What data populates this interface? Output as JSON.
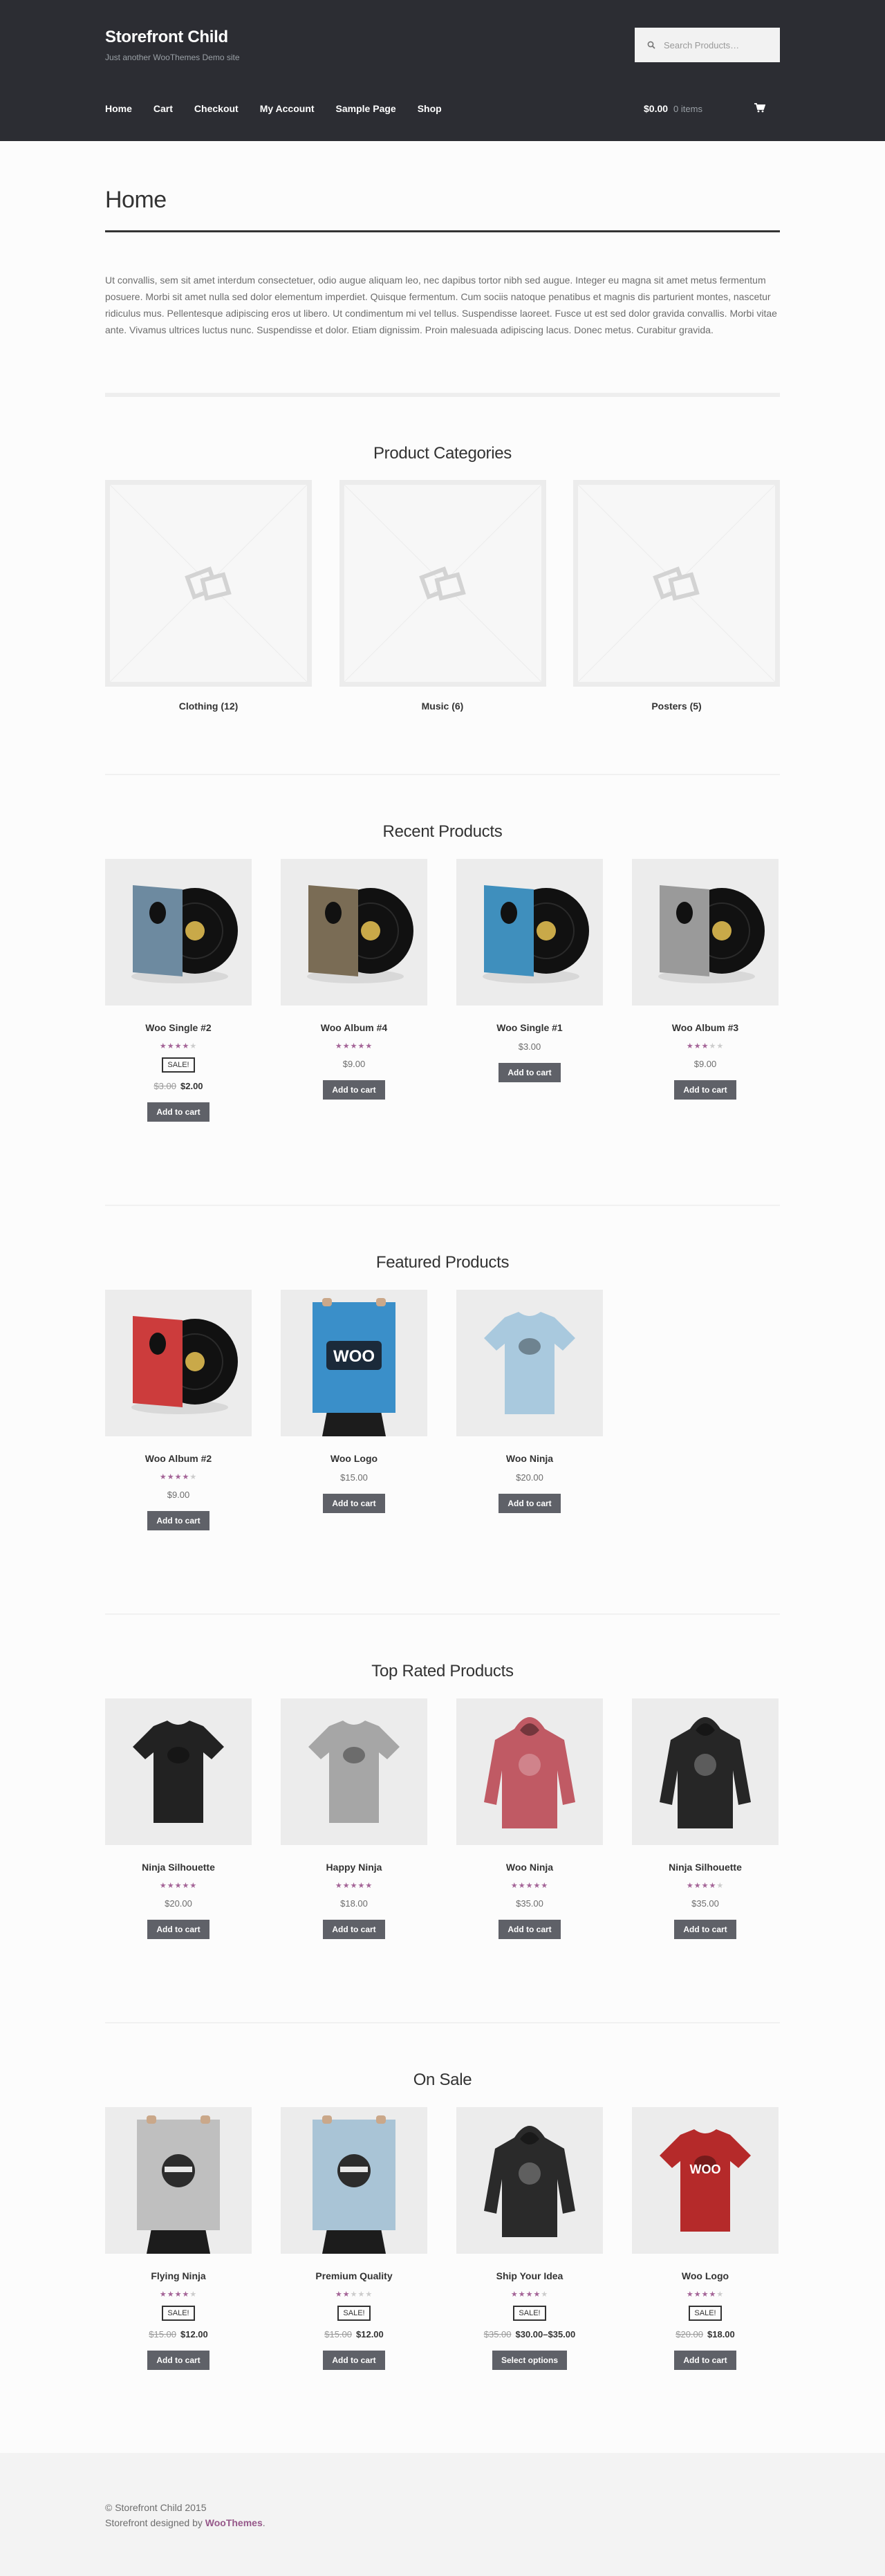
{
  "header": {
    "site_title": "Storefront Child",
    "tagline": "Just another WooThemes Demo site",
    "search_placeholder": "Search Products…",
    "nav": [
      "Home",
      "Cart",
      "Checkout",
      "My Account",
      "Sample Page",
      "Shop"
    ],
    "cart_amount": "$0.00",
    "cart_count": "0 items"
  },
  "page": {
    "title": "Home",
    "intro": "Ut convallis, sem sit amet interdum consectetuer, odio augue aliquam leo, nec dapibus tortor nibh sed augue. Integer eu magna sit amet metus fermentum posuere. Morbi sit amet nulla sed dolor elementum imperdiet. Quisque fermentum. Cum sociis natoque penatibus et magnis dis parturient montes, nascetur ridiculus mus. Pellentesque adipiscing eros ut libero. Ut condimentum mi vel tellus. Suspendisse laoreet. Fusce ut est sed dolor gravida convallis. Morbi vitae ante. Vivamus ultrices luctus nunc. Suspendisse et dolor. Etiam dignissim. Proin malesuada adipiscing lacus. Donec metus. Curabitur gravida."
  },
  "categories": {
    "title": "Product Categories",
    "items": [
      {
        "name": "Clothing",
        "count": "(12)"
      },
      {
        "name": "Music",
        "count": "(6)"
      },
      {
        "name": "Posters",
        "count": "(5)"
      }
    ]
  },
  "sections": [
    {
      "title": "Recent Products",
      "products": [
        {
          "name": "Woo Single #2",
          "rating": 4.5,
          "sale": "SALE!",
          "old_price": "$3.00",
          "price": "$2.00",
          "button": "Add to cart",
          "art": "vinyl",
          "color": "#6d8aa0"
        },
        {
          "name": "Woo Album #4",
          "rating": 5,
          "sale": "",
          "old_price": "",
          "price": "$9.00",
          "button": "Add to cart",
          "art": "vinyl",
          "color": "#7a6c55"
        },
        {
          "name": "Woo Single #1",
          "rating": 0,
          "sale": "",
          "old_price": "",
          "price": "$3.00",
          "button": "Add to cart",
          "art": "vinyl",
          "color": "#3f8fbd"
        },
        {
          "name": "Woo Album #3",
          "rating": 3,
          "sale": "",
          "old_price": "",
          "price": "$9.00",
          "button": "Add to cart",
          "art": "vinyl",
          "color": "#9a9a9a"
        }
      ]
    },
    {
      "title": "Featured Products",
      "products": [
        {
          "name": "Woo Album #2",
          "rating": 4,
          "sale": "",
          "old_price": "",
          "price": "$9.00",
          "button": "Add to cart",
          "art": "vinyl",
          "color": "#cc3c3c"
        },
        {
          "name": "Woo Logo",
          "rating": 0,
          "sale": "",
          "old_price": "",
          "price": "$15.00",
          "button": "Add to cart",
          "art": "poster",
          "color": "#3a8fc9",
          "logo": "WOO"
        },
        {
          "name": "Woo Ninja",
          "rating": 0,
          "sale": "",
          "old_price": "",
          "price": "$20.00",
          "button": "Add to cart",
          "art": "tshirt",
          "color": "#a9c9de"
        }
      ]
    },
    {
      "title": "Top Rated Products",
      "products": [
        {
          "name": "Ninja Silhouette",
          "rating": 5,
          "sale": "",
          "old_price": "",
          "price": "$20.00",
          "button": "Add to cart",
          "art": "tshirt",
          "color": "#222222"
        },
        {
          "name": "Happy Ninja",
          "rating": 5,
          "sale": "",
          "old_price": "",
          "price": "$18.00",
          "button": "Add to cart",
          "art": "tshirt",
          "color": "#a6a6a6"
        },
        {
          "name": "Woo Ninja",
          "rating": 5,
          "sale": "",
          "old_price": "",
          "price": "$35.00",
          "button": "Add to cart",
          "art": "hoodie",
          "color": "#c05a64"
        },
        {
          "name": "Ninja Silhouette",
          "rating": 4,
          "sale": "",
          "old_price": "",
          "price": "$35.00",
          "button": "Add to cart",
          "art": "hoodie",
          "color": "#262626"
        }
      ]
    },
    {
      "title": "On Sale",
      "products": [
        {
          "name": "Flying Ninja",
          "rating": 4,
          "sale": "SALE!",
          "old_price": "$15.00",
          "price": "$12.00",
          "button": "Add to cart",
          "art": "poster",
          "color": "#bfbfbf"
        },
        {
          "name": "Premium Quality",
          "rating": 2,
          "sale": "SALE!",
          "old_price": "$15.00",
          "price": "$12.00",
          "button": "Add to cart",
          "art": "poster",
          "color": "#a9c4d6"
        },
        {
          "name": "Ship Your Idea",
          "rating": 4,
          "sale": "SALE!",
          "old_price": "$35.00",
          "price": "$30.00–$35.00",
          "button": "Select options",
          "art": "hoodie",
          "color": "#2a2a2a"
        },
        {
          "name": "Woo Logo",
          "rating": 4,
          "sale": "SALE!",
          "old_price": "$20.00",
          "price": "$18.00",
          "button": "Add to cart",
          "art": "tshirt",
          "color": "#b52a2a",
          "logo": "WOO"
        }
      ]
    }
  ],
  "footer": {
    "copyright": "© Storefront Child 2015",
    "designed_by": "Storefront designed by",
    "designer": "WooThemes",
    "end": "."
  },
  "colors": {
    "header_bg": "#2c2d33",
    "accent": "#a46497",
    "button": "#5f6168"
  }
}
